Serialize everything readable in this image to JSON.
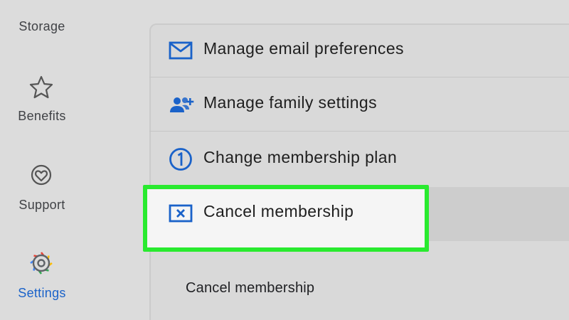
{
  "nav": {
    "items": [
      {
        "label": "Storage",
        "icon": "storage-icon",
        "active": false
      },
      {
        "label": "Benefits",
        "icon": "star-icon",
        "active": false
      },
      {
        "label": "Support",
        "icon": "support-icon",
        "active": false
      },
      {
        "label": "Settings",
        "icon": "settings-gear-icon",
        "active": true
      }
    ],
    "active_color": "#1a62c9"
  },
  "menu": {
    "items": [
      {
        "label": "Manage email preferences",
        "icon": "email-icon"
      },
      {
        "label": "Manage family settings",
        "icon": "family-icon"
      },
      {
        "label": "Change membership plan",
        "icon": "one-circle-icon"
      },
      {
        "label": "Cancel membership",
        "icon": "cancel-box-icon",
        "highlighted": true
      }
    ],
    "icon_color": "#1a62c9"
  },
  "footer_link": {
    "label": "Cancel membership"
  },
  "highlight": {
    "color": "#29ea2f"
  }
}
